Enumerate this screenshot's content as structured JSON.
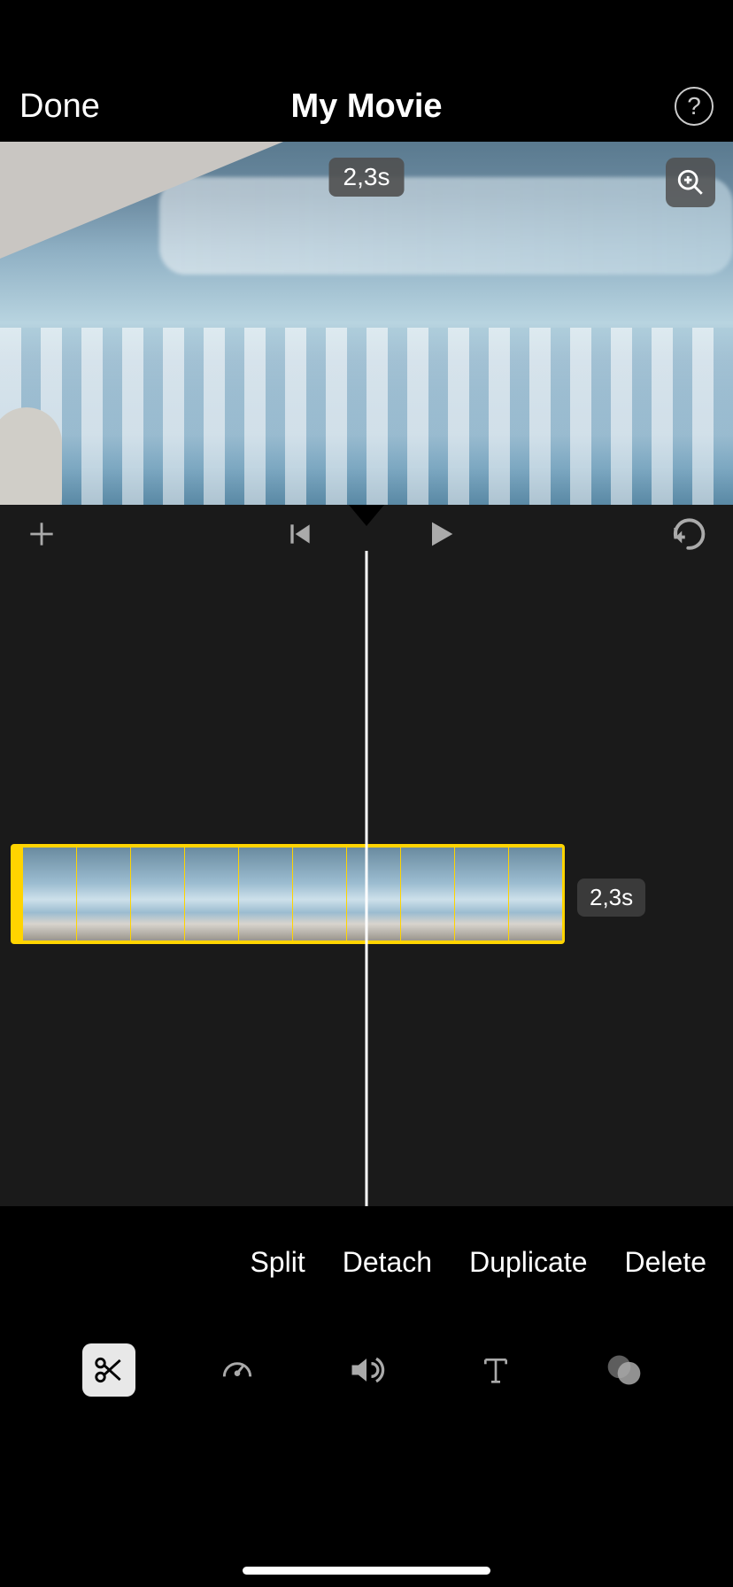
{
  "header": {
    "done": "Done",
    "title": "My Movie"
  },
  "preview": {
    "time_badge": "2,3s"
  },
  "timeline": {
    "clip_duration": "2,3s"
  },
  "actions": {
    "split": "Split",
    "detach": "Detach",
    "duplicate": "Duplicate",
    "delete": "Delete"
  }
}
